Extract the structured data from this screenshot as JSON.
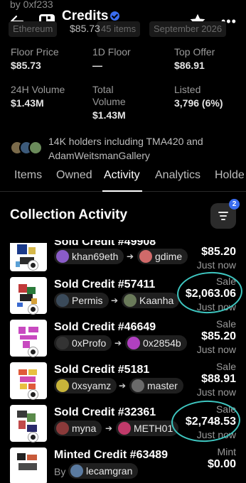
{
  "header": {
    "byline": "by 0xf233",
    "title": "Credits",
    "price_overlay": "$85.73",
    "chips": [
      "Ethereum",
      "45 items",
      "September 2026"
    ]
  },
  "stats": [
    {
      "label": "Floor Price",
      "value": "$85.73"
    },
    {
      "label": "1D Floor",
      "value": "—"
    },
    {
      "label": "Top Offer",
      "value": "$86.91"
    },
    {
      "label": "24H Volume",
      "value": "$1.43M"
    },
    {
      "label": "Total Volume",
      "value": "$1.43M"
    },
    {
      "label": "Listed",
      "value": "3,796 (6%)"
    }
  ],
  "holders_text": "14K holders including TMA420 and AdamWeitsmanGallery",
  "tabs": [
    "Items",
    "Owned",
    "Activity",
    "Analytics",
    "Holde"
  ],
  "active_tab": "Activity",
  "section_title": "Collection Activity",
  "filter_badge": "2",
  "activity": [
    {
      "title": "Sold Credit #49908",
      "from": "khan69eth",
      "to": "gdime",
      "type": "",
      "price": "$85.20",
      "time": "Just now"
    },
    {
      "title": "Sold Credit #57411",
      "from": "Permis",
      "to": "Kaanha",
      "type": "Sale",
      "price": "$2,063.06",
      "time": "Just now"
    },
    {
      "title": "Sold Credit #46649",
      "from": "0xProfo",
      "to": "0x2854b",
      "type": "Sale",
      "price": "$85.20",
      "time": "Just now"
    },
    {
      "title": "Sold Credit #5181",
      "from": "0xsyamz",
      "to": "master",
      "type": "Sale",
      "price": "$88.91",
      "time": "Just now"
    },
    {
      "title": "Sold Credit #32361",
      "from": "myna",
      "to": "METH01",
      "type": "Sale",
      "price": "$2,748.53",
      "time": "Just now"
    },
    {
      "title": "Minted Credit #63489",
      "by_label": "By",
      "from": "lecamgran",
      "type": "Mint",
      "price": "$0.00",
      "time": ""
    }
  ],
  "colors": {
    "accent": "#3a6df0",
    "highlight_circle": "#3ec6c0",
    "background": "#000000"
  }
}
